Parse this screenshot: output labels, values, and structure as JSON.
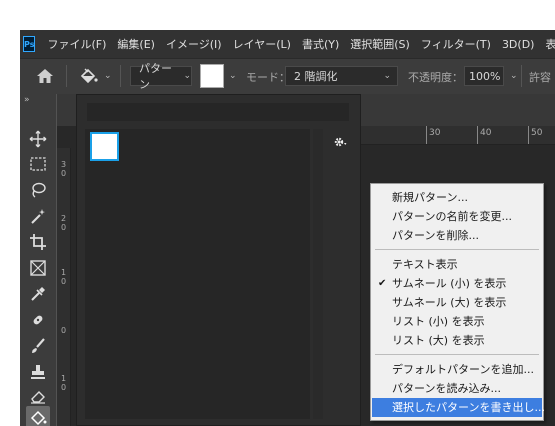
{
  "app": {
    "logo": "Ps"
  },
  "menubar": {
    "items": [
      "ファイル(F)",
      "編集(E)",
      "イメージ(I)",
      "レイヤー(L)",
      "書式(Y)",
      "選択範囲(S)",
      "フィルター(T)",
      "3D(D)",
      "表示(V)"
    ]
  },
  "options": {
    "fill_source": "パターン",
    "mode_label": "モード：",
    "mode_value": "2 階調化",
    "opacity_label": "不透明度：",
    "opacity_value": "100%",
    "tolerance_label": "許容"
  },
  "ruler": {
    "h_ticks": [
      "30",
      "40",
      "50"
    ],
    "v_ticks": [
      "3\n0",
      "2\n0",
      "1\n0",
      "0",
      "1\n0"
    ]
  },
  "context_menu": {
    "group1": [
      "新規パターン...",
      "パターンの名前を変更...",
      "パターンを削除..."
    ],
    "group2": [
      "テキスト表示",
      "サムネール (小) を表示",
      "サムネール (大) を表示",
      "リスト (小) を表示",
      "リスト (大) を表示"
    ],
    "checked_item": "サムネール (小) を表示",
    "group3": [
      "デフォルトパターンを追加...",
      "パターンを読み込み...",
      "選択したパターンを書き出し..."
    ],
    "highlighted_item": "選択したパターンを書き出し..."
  },
  "colors": {
    "accent": "#3d7ee0",
    "selection_border": "#1aa0e8"
  }
}
